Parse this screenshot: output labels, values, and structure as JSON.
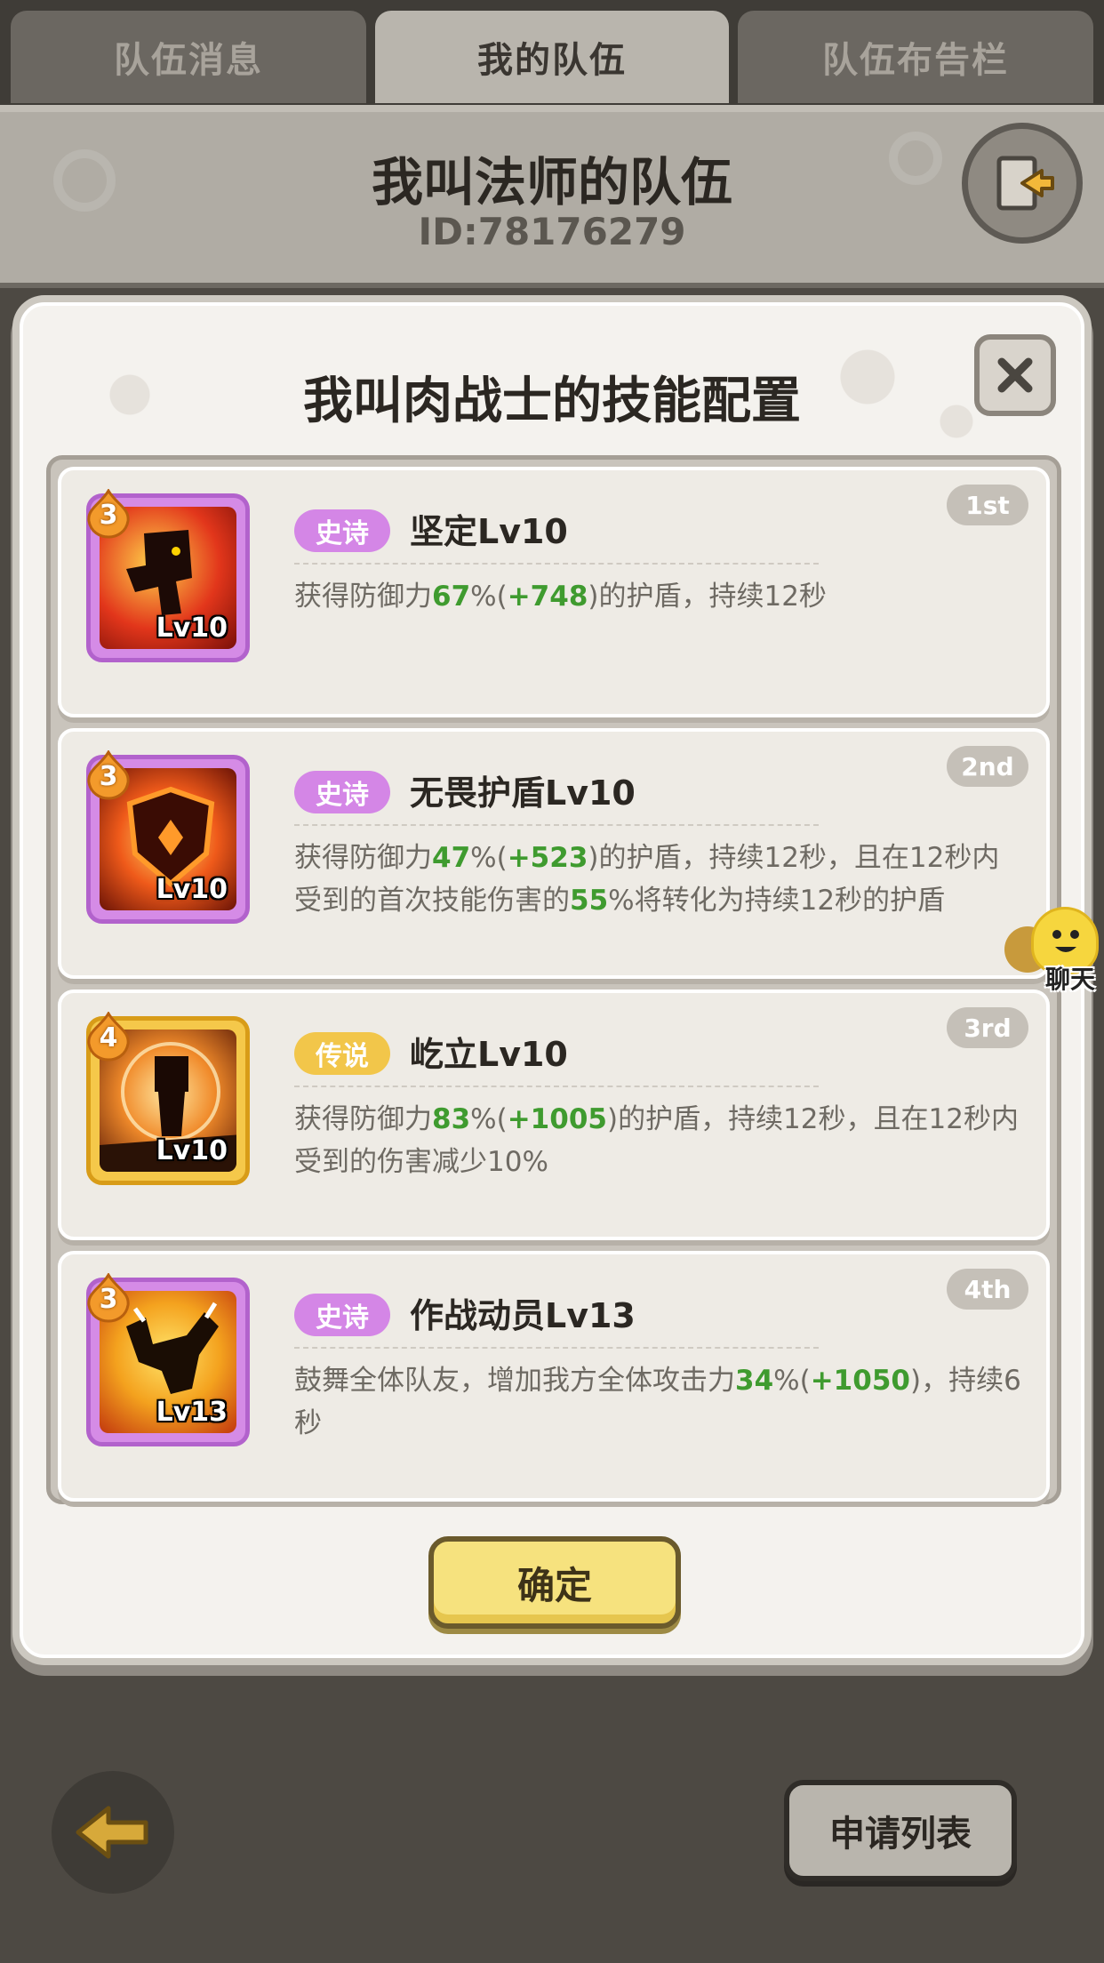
{
  "tabs": [
    {
      "label": "队伍消息",
      "active": false
    },
    {
      "label": "我的队伍",
      "active": true
    },
    {
      "label": "队伍布告栏",
      "active": false
    }
  ],
  "team": {
    "name": "我叫法师的队伍",
    "id": "ID:78176279"
  },
  "modal": {
    "title": "我叫肉战士的技能配置",
    "confirm_label": "确定",
    "skills": [
      {
        "rank": "1st",
        "stars": "3",
        "rarity": "史诗",
        "rarity_type": "epic",
        "name": "坚定Lv10",
        "icon_level": "Lv10",
        "desc": [
          {
            "text": "获得防御力"
          },
          {
            "text": "67",
            "hl": true
          },
          {
            "text": "%("
          },
          {
            "text": "+748",
            "hl": true
          },
          {
            "text": ")的护盾，持续12秒"
          }
        ]
      },
      {
        "rank": "2nd",
        "stars": "3",
        "rarity": "史诗",
        "rarity_type": "epic",
        "name": "无畏护盾Lv10",
        "icon_level": "Lv10",
        "desc": [
          {
            "text": "获得防御力"
          },
          {
            "text": "47",
            "hl": true
          },
          {
            "text": "%("
          },
          {
            "text": "+523",
            "hl": true
          },
          {
            "text": ")的护盾，持续12秒，且在12秒内受到的首次技能伤害的"
          },
          {
            "text": "55",
            "hl": true
          },
          {
            "text": "%将转化为持续12秒的护盾"
          }
        ]
      },
      {
        "rank": "3rd",
        "stars": "4",
        "rarity": "传说",
        "rarity_type": "legend",
        "name": "屹立Lv10",
        "icon_level": "Lv10",
        "desc": [
          {
            "text": "获得防御力"
          },
          {
            "text": "83",
            "hl": true
          },
          {
            "text": "%("
          },
          {
            "text": "+1005",
            "hl": true
          },
          {
            "text": ")的护盾，持续12秒，且在12秒内受到的伤害减少10%"
          }
        ]
      },
      {
        "rank": "4th",
        "stars": "3",
        "rarity": "史诗",
        "rarity_type": "epic",
        "name": "作战动员Lv13",
        "icon_level": "Lv13",
        "desc": [
          {
            "text": "鼓舞全体队友，增加我方全体攻击力"
          },
          {
            "text": "34",
            "hl": true
          },
          {
            "text": "%("
          },
          {
            "text": "+1050",
            "hl": true
          },
          {
            "text": ")，持续6秒"
          }
        ]
      }
    ]
  },
  "chat": {
    "label": "聊天"
  },
  "bottom": {
    "apply_list_label": "申请列表"
  },
  "colors": {
    "epic": "#d486e6",
    "legend": "#f2c64a",
    "highlight": "#3f9b2f",
    "confirm": "#f6e27e"
  },
  "icons": [
    "leave-team-icon",
    "close-icon",
    "back-arrow-icon",
    "chat-icon"
  ]
}
